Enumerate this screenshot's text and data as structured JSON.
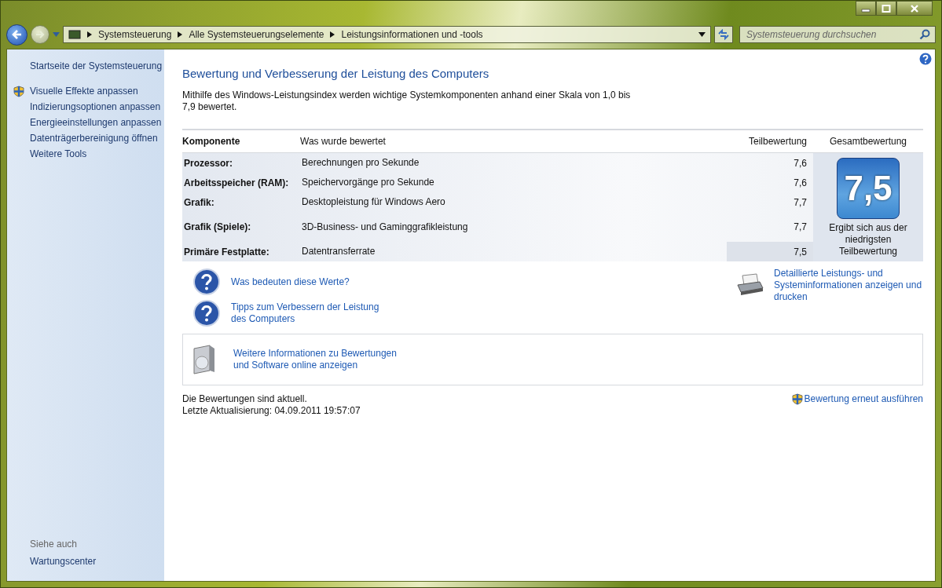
{
  "address_bar": {
    "crumbs": [
      "Systemsteuerung",
      "Alle Systemsteuerungselemente",
      "Leistungsinformationen und -tools"
    ]
  },
  "search": {
    "placeholder": "Systemsteuerung durchsuchen"
  },
  "sidebar": {
    "items": [
      {
        "label": "Startseite der Systemsteuerung",
        "shield": false
      },
      {
        "label": "Visuelle Effekte anpassen",
        "shield": true
      },
      {
        "label": "Indizierungsoptionen anpassen",
        "shield": false
      },
      {
        "label": "Energieeinstellungen anpassen",
        "shield": false
      },
      {
        "label": "Datenträgerbereinigung öffnen",
        "shield": false
      },
      {
        "label": "Weitere Tools",
        "shield": false
      }
    ],
    "see_also_heading": "Siehe auch",
    "see_also": [
      "Wartungscenter"
    ]
  },
  "heading": "Bewertung und Verbesserung der Leistung des Computers",
  "intro": "Mithilfe des Windows-Leistungsindex werden wichtige Systemkomponenten anhand einer Skala von 1,0 bis 7,9 bewertet.",
  "table": {
    "columns": [
      "Komponente",
      "Was wurde bewertet",
      "Teilbewertung",
      "Gesamtbewertung"
    ],
    "rows": [
      {
        "component": "Prozessor:",
        "rated": "Berechnungen pro Sekunde",
        "score": "7,6",
        "lowest": false
      },
      {
        "component": "Arbeitsspeicher (RAM):",
        "rated": "Speichervorgänge pro Sekunde",
        "score": "7,6",
        "lowest": false
      },
      {
        "component": "Grafik:",
        "rated": "Desktopleistung für Windows Aero",
        "score": "7,7",
        "lowest": false
      },
      {
        "component": "Grafik (Spiele):",
        "rated": "3D-Business- und Gaminggrafikleistung",
        "score": "7,7",
        "lowest": false
      },
      {
        "component": "Primäre Festplatte:",
        "rated": "Datentransferrate",
        "score": "7,5",
        "lowest": true
      }
    ],
    "total": "7,5",
    "total_caption": "Ergibt sich aus der niedrigsten Teilbewertung"
  },
  "help_links": [
    "Was bedeuten diese Werte?",
    "Tipps zum Verbessern der Leistung des Computers"
  ],
  "print_link": "Detaillierte Leistungs- und Systeminformationen anzeigen und drucken",
  "online_link": "Weitere Informationen zu Bewertungen und Software online anzeigen",
  "status": [
    "Die Bewertungen sind aktuell.",
    "Letzte Aktualisierung: 04.09.2011 19:57:07"
  ],
  "rerun_link": "Bewertung erneut ausführen"
}
